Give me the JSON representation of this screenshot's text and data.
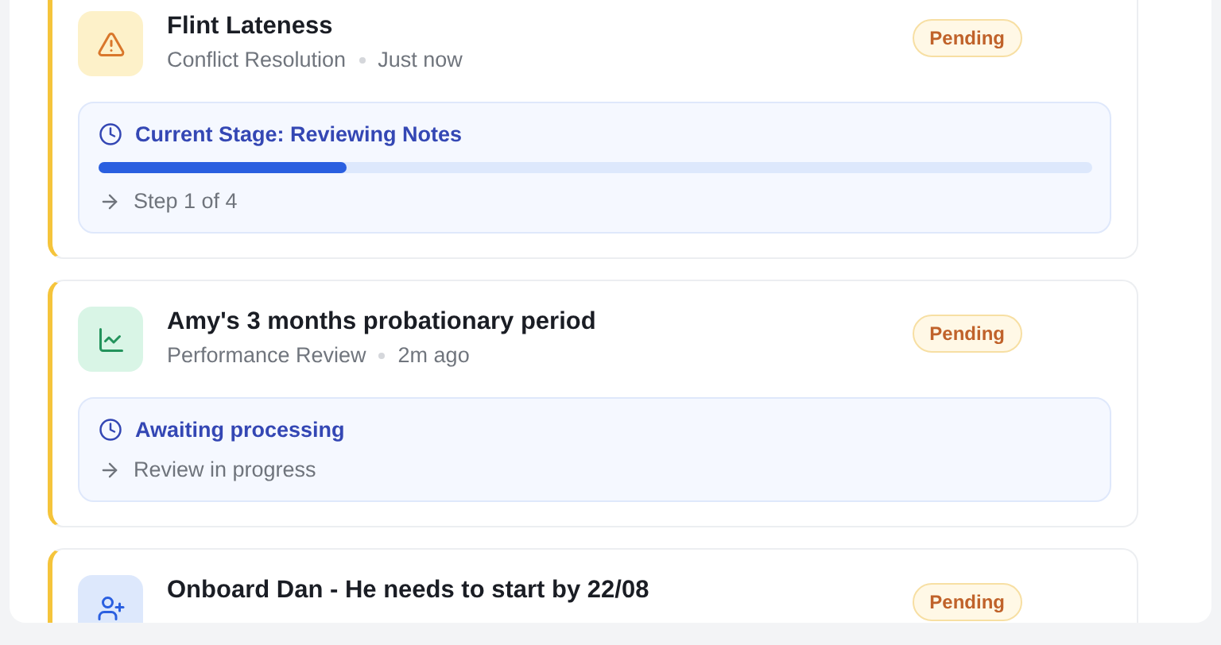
{
  "requests": [
    {
      "kind": "warning",
      "title": "Flint Lateness",
      "category": "Conflict Resolution",
      "time": "Just now",
      "badge": "Pending",
      "stage": {
        "label": "Current Stage: Reviewing Notes",
        "level": 0.25,
        "note": "Step 1 of 4"
      }
    },
    {
      "kind": "chart",
      "title": "Amy's 3 months probationary period",
      "category": "Performance Review",
      "time": "2m ago",
      "badge": "Pending",
      "stage": {
        "label": "Awaiting processing",
        "note": "Review in progress"
      }
    },
    {
      "kind": "user",
      "title": "Onboard Dan - He needs to start by 22/08",
      "badge": "Pending"
    }
  ]
}
